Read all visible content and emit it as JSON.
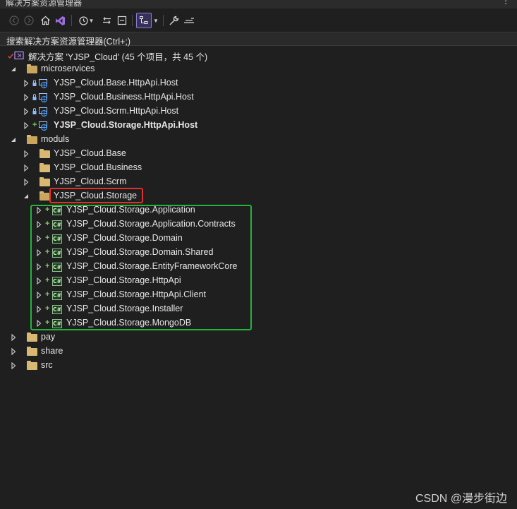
{
  "window": {
    "title": "解决方案资源管理器",
    "menu_glyph": "⋮"
  },
  "toolbar": {
    "buttons": [
      {
        "name": "back-button",
        "icon": "back-icon"
      },
      {
        "name": "forward-button",
        "icon": "forward-icon"
      },
      {
        "name": "home-button",
        "icon": "home-icon"
      },
      {
        "name": "vs-switch-views-button",
        "icon": "vs-logo-icon"
      },
      {
        "name": "pending-changes-button",
        "icon": "history-icon"
      },
      {
        "name": "sync-button",
        "icon": "sync-icon"
      },
      {
        "name": "collapse-all-button",
        "icon": "collapse-icon"
      },
      {
        "name": "show-all-files-button",
        "icon": "tree-view-icon",
        "active": true
      },
      {
        "name": "properties-button",
        "icon": "wrench-icon"
      },
      {
        "name": "preview-button",
        "icon": "preview-icon"
      }
    ]
  },
  "search": {
    "placeholder": "搜索解决方案资源管理器(Ctrl+;)"
  },
  "solution": {
    "label": "解决方案 'YJSP_Cloud' (45 个项目，共 45 个)"
  },
  "tree": [
    {
      "label": "microservices",
      "type": "folder",
      "expanded": true
    },
    {
      "label": "YJSP_Cloud.Base.HttpApi.Host",
      "type": "web-project",
      "marker": "lock"
    },
    {
      "label": "YJSP_Cloud.Business.HttpApi.Host",
      "type": "web-project",
      "marker": "lock"
    },
    {
      "label": "YJSP_Cloud.Scrm.HttpApi.Host",
      "type": "web-project",
      "marker": "lock"
    },
    {
      "label": "YJSP_Cloud.Storage.HttpApi.Host",
      "type": "web-project",
      "marker": "plus",
      "bold": true
    },
    {
      "label": "moduls",
      "type": "folder",
      "expanded": true
    },
    {
      "label": "YJSP_Cloud.Base",
      "type": "folder",
      "expanded": false
    },
    {
      "label": "YJSP_Cloud.Business",
      "type": "folder",
      "expanded": false
    },
    {
      "label": "YJSP_Cloud.Scrm",
      "type": "folder",
      "expanded": false
    },
    {
      "label": "YJSP_Cloud.Storage",
      "type": "folder",
      "expanded": true
    },
    {
      "label": "YJSP_Cloud.Storage.Application",
      "type": "cs-project",
      "marker": "plus"
    },
    {
      "label": "YJSP_Cloud.Storage.Application.Contracts",
      "type": "cs-project",
      "marker": "plus"
    },
    {
      "label": "YJSP_Cloud.Storage.Domain",
      "type": "cs-project",
      "marker": "plus"
    },
    {
      "label": "YJSP_Cloud.Storage.Domain.Shared",
      "type": "cs-project",
      "marker": "plus"
    },
    {
      "label": "YJSP_Cloud.Storage.EntityFrameworkCore",
      "type": "cs-project",
      "marker": "plus"
    },
    {
      "label": "YJSP_Cloud.Storage.HttpApi",
      "type": "cs-project",
      "marker": "plus"
    },
    {
      "label": "YJSP_Cloud.Storage.HttpApi.Client",
      "type": "cs-project",
      "marker": "plus"
    },
    {
      "label": "YJSP_Cloud.Storage.Installer",
      "type": "cs-project",
      "marker": "plus"
    },
    {
      "label": "YJSP_Cloud.Storage.MongoDB",
      "type": "cs-project",
      "marker": "plus"
    },
    {
      "label": "pay",
      "type": "folder",
      "expanded": false
    },
    {
      "label": "share",
      "type": "folder",
      "expanded": false
    },
    {
      "label": "src",
      "type": "folder",
      "expanded": false
    }
  ],
  "cs_badge": "C#",
  "watermark": "CSDN @漫步街边",
  "colors": {
    "highlight_red": "#e0302a",
    "highlight_green": "#21b53a",
    "folder": "#d9b873",
    "background": "#1f1f1f"
  }
}
